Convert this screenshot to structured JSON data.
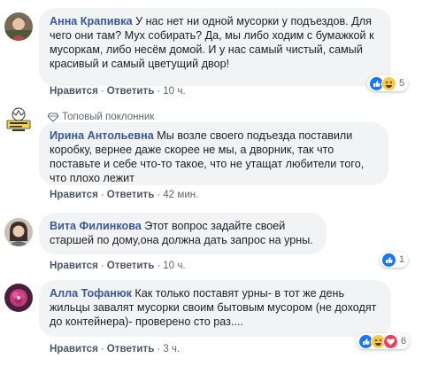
{
  "comments": [
    {
      "author": "Анна Крапивка",
      "text": "У нас нет ни одной мусорки у подъездов. Для чего они там? Мух собирать? Да, мы либо ходим с бумажкой к мусоркам, либо несём домой. И у нас самый чистый, самый красивый и самый цветущий двор!",
      "like_label": "Нравится",
      "reply_label": "Ответить",
      "time": "10 ч.",
      "reaction_count": "5",
      "reactions": [
        "like-icon",
        "haha-icon"
      ]
    },
    {
      "badge": "Топовый поклонник",
      "author": "Ирина Антольевна",
      "text": "Мы возле своего подъезда поставили коробку, вернее даже скорее не мы, а дворник, так что поставьте и себе что-то такое, что не утащат любители того, что плохо лежит",
      "like_label": "Нравится",
      "reply_label": "Ответить",
      "time": "42 мин."
    },
    {
      "author": "Вита Филинкова",
      "text": "Этот вопрос задайте своей старшей по дому,она должна дать запрос на урны.",
      "like_label": "Нравится",
      "reply_label": "Ответить",
      "time": "10 ч.",
      "reaction_count": "1",
      "reactions": [
        "like-icon"
      ]
    },
    {
      "author": "Алла Тофанюк",
      "text": "Как только поставят урны- в тот же день жильцы завалят мусорки своим бытовым мусором (не доходят до контейнера)- проверено сто раз....",
      "like_label": "Нравится",
      "reply_label": "Ответить",
      "time": "3 ч.",
      "reaction_count": "6",
      "reactions": [
        "like-icon",
        "haha-icon",
        "heart-icon"
      ]
    }
  ],
  "colors": {
    "author": "#385898",
    "bubble": "#f2f3f5",
    "meta": "#606770",
    "like": "#1877f2",
    "haha": "#f7c94a",
    "heart": "#f33e58"
  }
}
